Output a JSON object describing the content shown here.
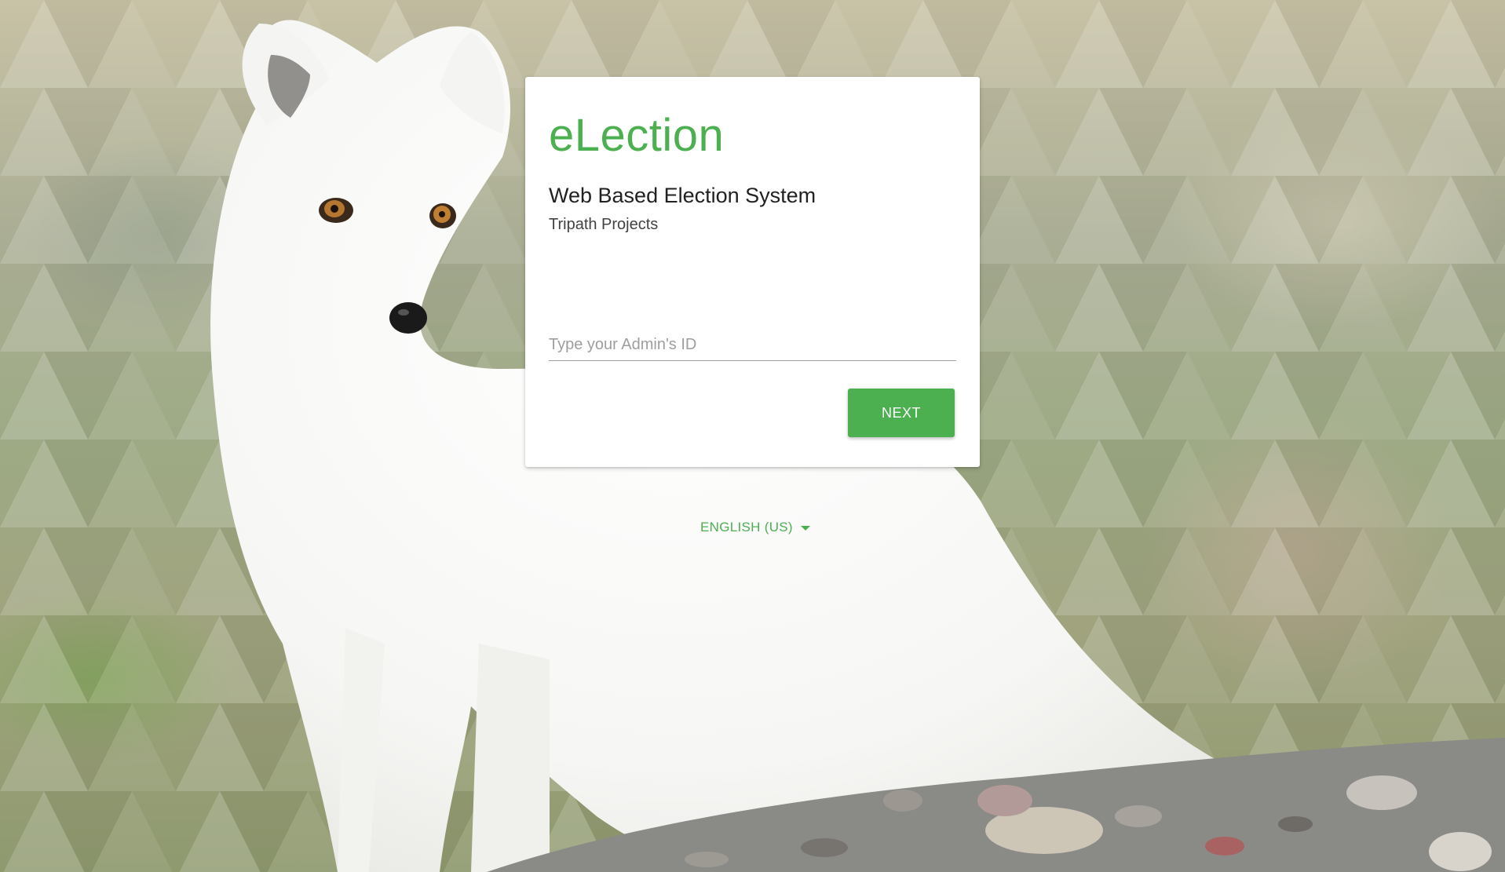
{
  "theme": {
    "accent": "#4caf50",
    "card_background": "#ffffff"
  },
  "background": {
    "image_subject": "arctic-fox"
  },
  "login_card": {
    "brand": "eLection",
    "subtitle": "Web Based Election System",
    "organization": "Tripath Projects",
    "admin_id_input": {
      "value": "",
      "placeholder": "Type your Admin's ID"
    },
    "next_button_label": "NEXT"
  },
  "language_selector": {
    "selected": "ENGLISH (US)",
    "icon": "caret-down-icon"
  }
}
